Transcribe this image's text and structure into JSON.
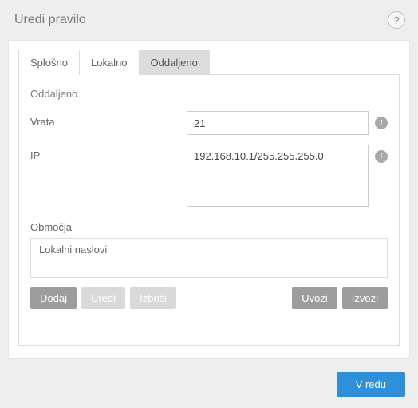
{
  "title": "Uredi pravilo",
  "help_tooltip": "?",
  "tabs": {
    "general": "Splošno",
    "local": "Lokalno",
    "remote": "Oddaljeno"
  },
  "panel": {
    "heading": "Oddaljeno",
    "port_label": "Vrata",
    "port_value": "21",
    "ip_label": "IP",
    "ip_value": "192.168.10.1/255.255.255.0",
    "zones_label": "Območja",
    "zones_item": "Lokalni naslovi"
  },
  "buttons": {
    "add": "Dodaj",
    "edit": "Uredi",
    "delete": "Izbriši",
    "import": "Uvozi",
    "export": "Izvozi",
    "ok": "V redu"
  }
}
